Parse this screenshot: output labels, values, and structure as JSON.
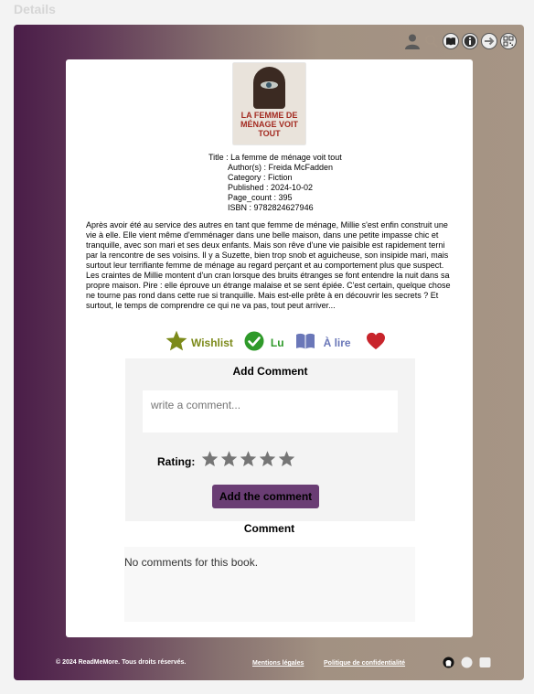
{
  "page": {
    "label": "Details"
  },
  "topbar": {
    "icons": [
      "user-icon",
      "search-icon",
      "book-icon",
      "info-icon",
      "arrow-right-icon",
      "qr-code-icon"
    ]
  },
  "book": {
    "cover_text": "LA FEMME DE MÉNAGE VOIT TOUT",
    "title_line": "Title : La femme de ménage voit tout",
    "authors_line": "Author(s) : Freida McFadden",
    "category_line": "Category : Fiction",
    "published_line": "Published : 2024-10-02",
    "page_count_line": "Page_count : 395",
    "isbn_line": "ISBN : 9782824627946",
    "description": "Après avoir été au service des autres en tant que femme de ménage, Millie s'est enfin construit une vie à elle. Elle vient même d'emménager dans une belle maison, dans une petite impasse chic et tranquille, avec son mari et ses deux enfants. Mais son rêve d'une vie paisible est rapidement terni par la rencontre de ses voisins. Il y a Suzette, bien trop snob et aguicheuse, son insipide mari, mais surtout leur terrifiante femme de ménage au regard perçant et au comportement plus que suspect. Les craintes de Millie montent d'un cran lorsque des bruits étranges se font entendre la nuit dans sa propre maison. Pire : elle éprouve un étrange malaise et se sent épiée. C'est certain, quelque chose ne tourne pas rond dans cette rue si tranquille. Mais est-elle prête à en découvrir les secrets ? Et surtout, le temps de comprendre ce qui ne va pas, tout peut arriver..."
  },
  "actions": {
    "wishlist": {
      "label": "Wishlist",
      "color": "#7c8a1a",
      "icon": "star-icon"
    },
    "lu": {
      "label": "Lu",
      "color": "#2f9a2a",
      "icon": "check-circle-icon"
    },
    "a_lire": {
      "label": "À lire",
      "color": "#6a77b8",
      "icon": "open-book-icon"
    },
    "favorite": {
      "color": "#c8242b",
      "icon": "heart-icon"
    }
  },
  "add_comment": {
    "heading": "Add Comment",
    "placeholder": "write a comment...",
    "rating_label": "Rating:",
    "rating_value": 0,
    "rating_max": 5,
    "button_label": "Add the comment"
  },
  "comments": {
    "heading": "Comment",
    "empty_text": "No comments for this book."
  },
  "footer": {
    "copyright": "© 2024 ReadMeMore. Tous droits réservés.",
    "legal_link": "Mentions légales",
    "privacy_link": "Politique de confidentialité",
    "icons": [
      "github-icon",
      "social-icon",
      "mail-icon"
    ]
  }
}
